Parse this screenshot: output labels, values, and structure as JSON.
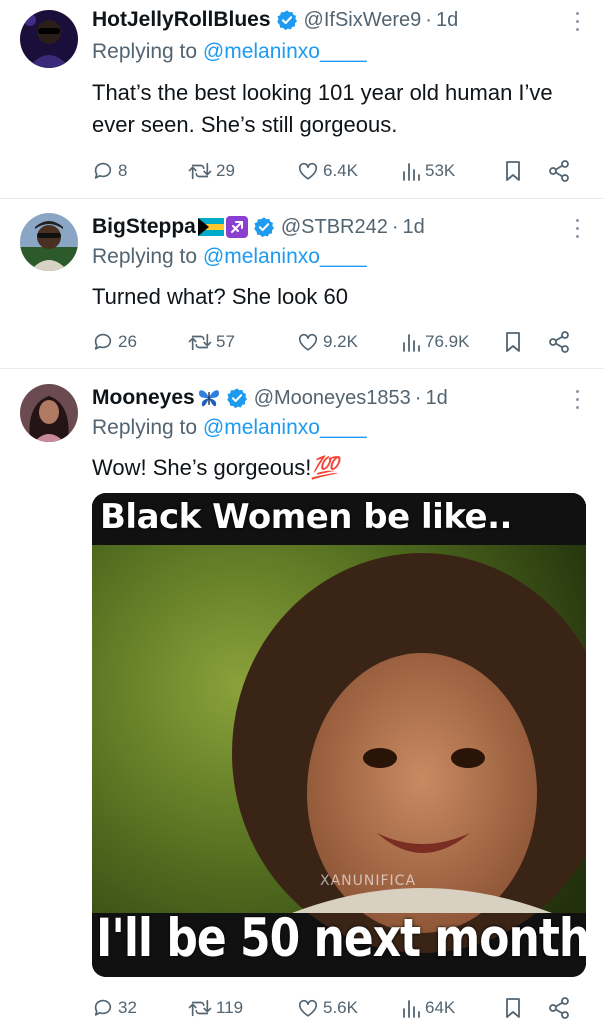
{
  "tweets": [
    {
      "name": "HotJellyRollBlues",
      "handle": "@IfSixWere9",
      "separator": "·",
      "time": "1d",
      "replying_prefix": "Replying to ",
      "replying_to": "@melaninxo____",
      "text": "That’s the best looking 101 year old human I’ve ever seen. She’s still gorgeous.",
      "replies": "8",
      "retweets": "29",
      "likes": "6.4K",
      "views": "53K"
    },
    {
      "name": "BigSteppa",
      "handle": "@STBR242",
      "separator": "·",
      "time": "1d",
      "replying_prefix": "Replying to ",
      "replying_to": "@melaninxo____",
      "text": "Turned what? She look 60",
      "replies": "26",
      "retweets": "57",
      "likes": "9.2K",
      "views": "76.9K"
    },
    {
      "name": "Mooneyes",
      "handle": "@Mooneyes1853",
      "separator": "·",
      "time": "1d",
      "replying_prefix": "Replying to ",
      "replying_to": "@melaninxo____",
      "text": "Wow! She’s gorgeous!",
      "text_emoji": "💯",
      "media": {
        "top_caption": "Black Women be like..",
        "bottom_caption": "I'll be 50 next month",
        "watermark": "XANUNIFICA"
      },
      "replies": "32",
      "retweets": "119",
      "likes": "5.6K",
      "views": "64K"
    }
  ],
  "colors": {
    "text_primary": "#0f1419",
    "text_secondary": "#536471",
    "accent_blue": "#1d9bf0",
    "divider": "#e6ecf0"
  },
  "icons": [
    "reply-icon",
    "retweet-icon",
    "like-icon",
    "views-icon",
    "bookmark-icon",
    "share-icon",
    "verified-badge-icon",
    "more-options-icon"
  ]
}
